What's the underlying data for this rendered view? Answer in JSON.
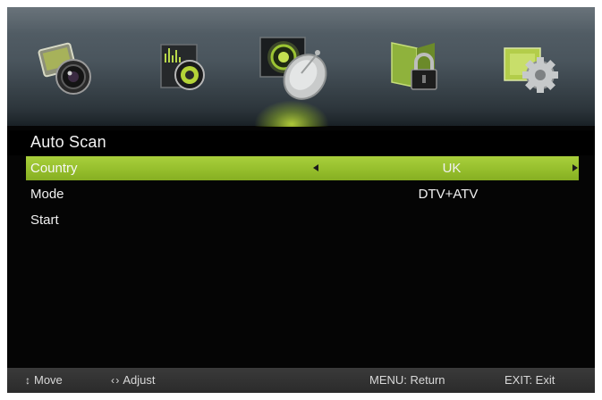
{
  "menu": {
    "tabs": [
      {
        "name": "picture",
        "icon": "picture-lens-icon",
        "selected": false
      },
      {
        "name": "sound",
        "icon": "sound-speaker-icon",
        "selected": false
      },
      {
        "name": "channel",
        "icon": "satellite-dish-icon",
        "selected": true
      },
      {
        "name": "lock",
        "icon": "padlock-icon",
        "selected": false
      },
      {
        "name": "setup",
        "icon": "settings-gear-icon",
        "selected": false
      }
    ],
    "accent_color": "#9cc533"
  },
  "page": {
    "title": "Auto Scan"
  },
  "options": [
    {
      "label": "Country",
      "value": "UK",
      "selected": true,
      "has_arrows": true
    },
    {
      "label": "Mode",
      "value": "DTV+ATV",
      "selected": false,
      "has_arrows": false
    },
    {
      "label": "Start",
      "value": "",
      "selected": false,
      "has_arrows": false
    }
  ],
  "footer": {
    "move_icon": "↕",
    "move": "Move",
    "adjust_icon": "‹ ›",
    "adjust": "Adjust",
    "return": "MENU: Return",
    "exit": "EXIT: Exit"
  }
}
